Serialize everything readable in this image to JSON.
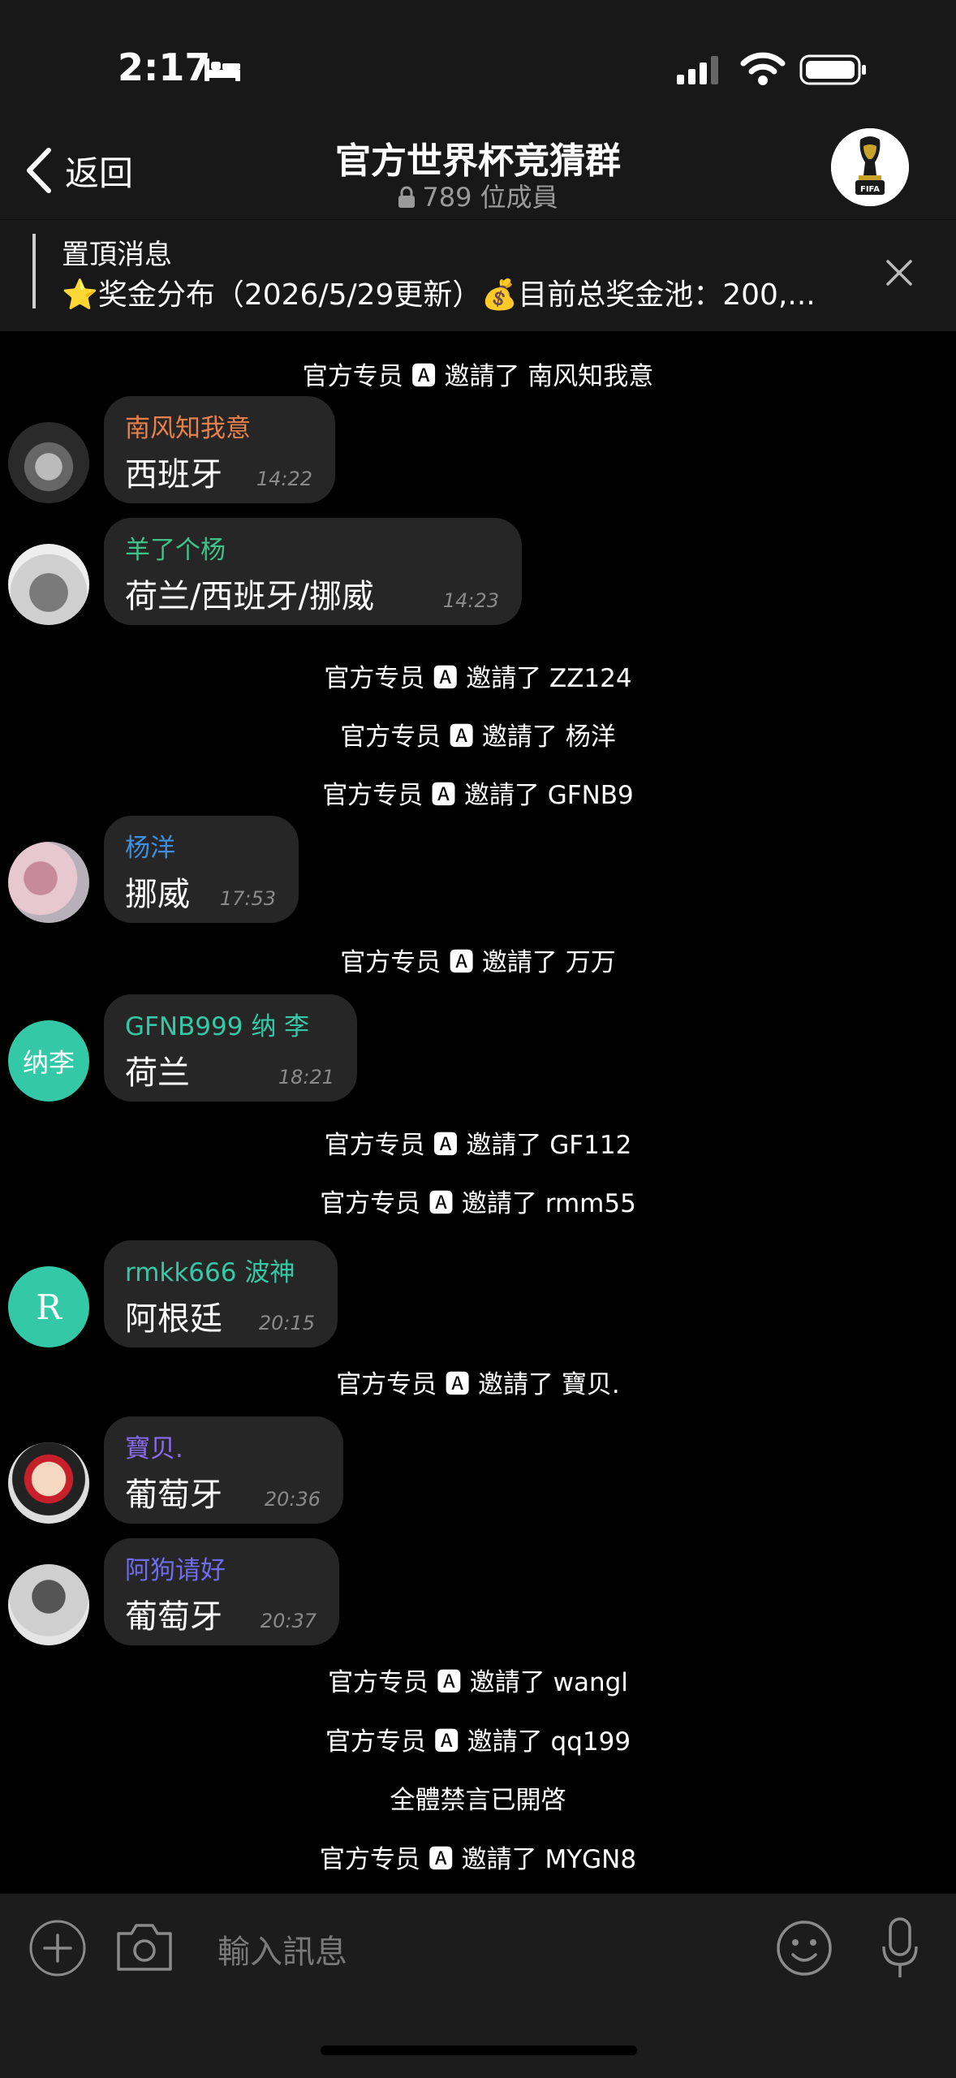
{
  "status": {
    "time": "2:17"
  },
  "nav": {
    "back": "返回",
    "title": "官方世界杯竞猜群",
    "members": "789 位成員"
  },
  "pinned": {
    "title": "置頂消息",
    "text": "⭐奖金分布（2026/5/29更新）💰目前总奖金池：200,..."
  },
  "sys_msgs": [
    "官方专员 🅰 邀請了 南风知我意",
    "官方专员 🅰 邀請了 ZZ124",
    "官方专员 🅰 邀請了 杨洋",
    "官方专员 🅰 邀請了 GFNB9",
    "官方专员 🅰 邀請了 万万",
    "官方专员 🅰 邀請了 GF112",
    "官方专员 🅰 邀請了 rmm55",
    "官方专员 🅰 邀請了 寶贝.",
    "官方专员 🅰 邀請了 wangl",
    "官方专员 🅰 邀請了 qq199",
    "全體禁言已開啓",
    "官方专员 🅰 邀請了 MYGN8"
  ],
  "messages": [
    {
      "sender": "南风知我意",
      "text": "西班牙",
      "time": "14:22",
      "color": "#e8804a"
    },
    {
      "sender": "羊了个杨",
      "text": "荷兰/西班牙/挪威",
      "time": "14:23",
      "color": "#3fc28a"
    },
    {
      "sender": "杨洋",
      "text": "挪威",
      "time": "17:53",
      "color": "#3d8fe0"
    },
    {
      "sender": "GFNB999 纳 李",
      "text": "荷兰",
      "time": "18:21",
      "color": "#36c7a4",
      "avatar_letter": "纳李"
    },
    {
      "sender": "rmkk666 波神",
      "text": "阿根廷",
      "time": "20:15",
      "color": "#36c7a4",
      "avatar_letter": "R"
    },
    {
      "sender": "寶贝.",
      "text": "葡萄牙",
      "time": "20:36",
      "color": "#8a6cf0"
    },
    {
      "sender": "阿狗请好",
      "text": "葡萄牙",
      "time": "20:37",
      "color": "#6f6cf0"
    }
  ],
  "input": {
    "placeholder": "輸入訊息"
  }
}
